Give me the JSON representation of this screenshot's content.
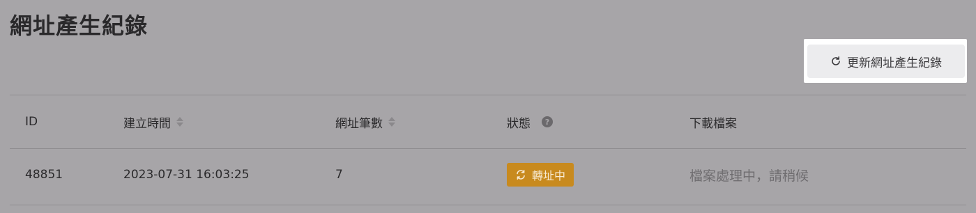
{
  "page": {
    "title": "網址產生紀錄"
  },
  "toolbar": {
    "refresh_label": "更新網址產生紀錄"
  },
  "table": {
    "headers": {
      "id": "ID",
      "created": "建立時間",
      "count": "網址筆數",
      "status": "狀態",
      "download": "下載檔案"
    },
    "help_glyph": "?",
    "rows": [
      {
        "id": "48851",
        "created": "2023-07-31 16:03:25",
        "count": "7",
        "status": "轉址中",
        "download": "檔案處理中，請稍候"
      }
    ]
  },
  "colors": {
    "overlay_background": "#a7a5a8",
    "status_badge": "#c88a1e",
    "highlight": "#ffffff"
  },
  "icons": {
    "refresh": "refresh-icon",
    "sort": "sort-icon",
    "help": "help-icon",
    "status_sync": "sync-icon"
  }
}
